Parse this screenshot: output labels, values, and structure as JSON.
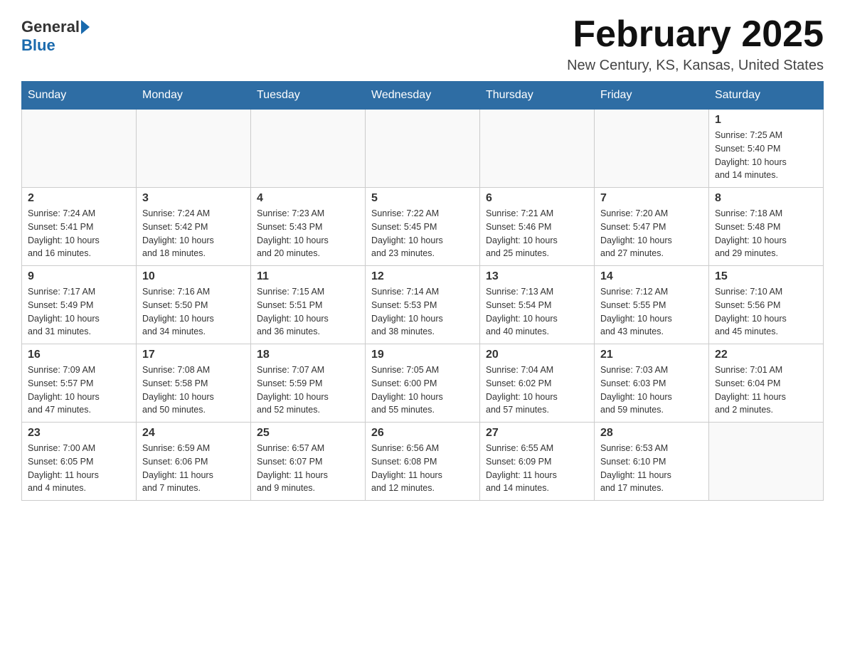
{
  "header": {
    "logo": {
      "part1": "General",
      "part2": "Blue"
    },
    "title": "February 2025",
    "location": "New Century, KS, Kansas, United States"
  },
  "days_of_week": [
    "Sunday",
    "Monday",
    "Tuesday",
    "Wednesday",
    "Thursday",
    "Friday",
    "Saturday"
  ],
  "weeks": [
    [
      {
        "day": "",
        "info": ""
      },
      {
        "day": "",
        "info": ""
      },
      {
        "day": "",
        "info": ""
      },
      {
        "day": "",
        "info": ""
      },
      {
        "day": "",
        "info": ""
      },
      {
        "day": "",
        "info": ""
      },
      {
        "day": "1",
        "info": "Sunrise: 7:25 AM\nSunset: 5:40 PM\nDaylight: 10 hours\nand 14 minutes."
      }
    ],
    [
      {
        "day": "2",
        "info": "Sunrise: 7:24 AM\nSunset: 5:41 PM\nDaylight: 10 hours\nand 16 minutes."
      },
      {
        "day": "3",
        "info": "Sunrise: 7:24 AM\nSunset: 5:42 PM\nDaylight: 10 hours\nand 18 minutes."
      },
      {
        "day": "4",
        "info": "Sunrise: 7:23 AM\nSunset: 5:43 PM\nDaylight: 10 hours\nand 20 minutes."
      },
      {
        "day": "5",
        "info": "Sunrise: 7:22 AM\nSunset: 5:45 PM\nDaylight: 10 hours\nand 23 minutes."
      },
      {
        "day": "6",
        "info": "Sunrise: 7:21 AM\nSunset: 5:46 PM\nDaylight: 10 hours\nand 25 minutes."
      },
      {
        "day": "7",
        "info": "Sunrise: 7:20 AM\nSunset: 5:47 PM\nDaylight: 10 hours\nand 27 minutes."
      },
      {
        "day": "8",
        "info": "Sunrise: 7:18 AM\nSunset: 5:48 PM\nDaylight: 10 hours\nand 29 minutes."
      }
    ],
    [
      {
        "day": "9",
        "info": "Sunrise: 7:17 AM\nSunset: 5:49 PM\nDaylight: 10 hours\nand 31 minutes."
      },
      {
        "day": "10",
        "info": "Sunrise: 7:16 AM\nSunset: 5:50 PM\nDaylight: 10 hours\nand 34 minutes."
      },
      {
        "day": "11",
        "info": "Sunrise: 7:15 AM\nSunset: 5:51 PM\nDaylight: 10 hours\nand 36 minutes."
      },
      {
        "day": "12",
        "info": "Sunrise: 7:14 AM\nSunset: 5:53 PM\nDaylight: 10 hours\nand 38 minutes."
      },
      {
        "day": "13",
        "info": "Sunrise: 7:13 AM\nSunset: 5:54 PM\nDaylight: 10 hours\nand 40 minutes."
      },
      {
        "day": "14",
        "info": "Sunrise: 7:12 AM\nSunset: 5:55 PM\nDaylight: 10 hours\nand 43 minutes."
      },
      {
        "day": "15",
        "info": "Sunrise: 7:10 AM\nSunset: 5:56 PM\nDaylight: 10 hours\nand 45 minutes."
      }
    ],
    [
      {
        "day": "16",
        "info": "Sunrise: 7:09 AM\nSunset: 5:57 PM\nDaylight: 10 hours\nand 47 minutes."
      },
      {
        "day": "17",
        "info": "Sunrise: 7:08 AM\nSunset: 5:58 PM\nDaylight: 10 hours\nand 50 minutes."
      },
      {
        "day": "18",
        "info": "Sunrise: 7:07 AM\nSunset: 5:59 PM\nDaylight: 10 hours\nand 52 minutes."
      },
      {
        "day": "19",
        "info": "Sunrise: 7:05 AM\nSunset: 6:00 PM\nDaylight: 10 hours\nand 55 minutes."
      },
      {
        "day": "20",
        "info": "Sunrise: 7:04 AM\nSunset: 6:02 PM\nDaylight: 10 hours\nand 57 minutes."
      },
      {
        "day": "21",
        "info": "Sunrise: 7:03 AM\nSunset: 6:03 PM\nDaylight: 10 hours\nand 59 minutes."
      },
      {
        "day": "22",
        "info": "Sunrise: 7:01 AM\nSunset: 6:04 PM\nDaylight: 11 hours\nand 2 minutes."
      }
    ],
    [
      {
        "day": "23",
        "info": "Sunrise: 7:00 AM\nSunset: 6:05 PM\nDaylight: 11 hours\nand 4 minutes."
      },
      {
        "day": "24",
        "info": "Sunrise: 6:59 AM\nSunset: 6:06 PM\nDaylight: 11 hours\nand 7 minutes."
      },
      {
        "day": "25",
        "info": "Sunrise: 6:57 AM\nSunset: 6:07 PM\nDaylight: 11 hours\nand 9 minutes."
      },
      {
        "day": "26",
        "info": "Sunrise: 6:56 AM\nSunset: 6:08 PM\nDaylight: 11 hours\nand 12 minutes."
      },
      {
        "day": "27",
        "info": "Sunrise: 6:55 AM\nSunset: 6:09 PM\nDaylight: 11 hours\nand 14 minutes."
      },
      {
        "day": "28",
        "info": "Sunrise: 6:53 AM\nSunset: 6:10 PM\nDaylight: 11 hours\nand 17 minutes."
      },
      {
        "day": "",
        "info": ""
      }
    ]
  ]
}
